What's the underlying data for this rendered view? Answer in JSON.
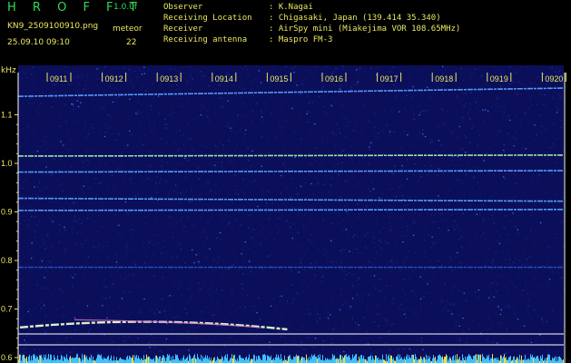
{
  "header": {
    "app_title": "H R O F F T",
    "version": "1.0.0f",
    "file_name": "KN9_2509100910.png",
    "meteor_label": "meteor",
    "datetime": "25.09.10 09:10",
    "meteor_count": "22",
    "info": [
      {
        "label": "Observer",
        "value": ": K.Nagai"
      },
      {
        "label": "Receiving Location",
        "value": ": Chigasaki, Japan (139.414 35.340)"
      },
      {
        "label": "Receiver",
        "value": ": AirSpy mini (Miakejima VOR 108.65MHz)"
      },
      {
        "label": "Receiving antenna",
        "value": ": Maspro FM-3"
      }
    ]
  },
  "spectrogram": {
    "y_unit": "kHz",
    "y_ticks": [
      "1.1",
      "1.0",
      "0.9",
      "0.8",
      "0.7",
      "0.6"
    ],
    "y_tick_values": [
      1.1,
      1.0,
      0.9,
      0.8,
      0.7,
      0.6
    ],
    "time_ticks": [
      "0911",
      "0912",
      "0913",
      "0914",
      "0915",
      "0916",
      "0917",
      "0918",
      "0919",
      "0920"
    ],
    "background_color": "#0b0f5a",
    "signals": [
      {
        "freq_start": 1.138,
        "freq_end": 1.155,
        "time_start": 0.0,
        "time_end": 10.0,
        "color": "#5aa0ff"
      },
      {
        "freq_start": 1.015,
        "freq_end": 1.017,
        "time_start": 0.0,
        "time_end": 10.0,
        "color": "#9cf0b0"
      },
      {
        "freq_start": 0.982,
        "freq_end": 0.985,
        "time_start": 0.0,
        "time_end": 10.0,
        "color": "#5aa0ff"
      },
      {
        "freq_start": 0.928,
        "freq_end": 0.922,
        "time_start": 0.0,
        "time_end": 10.0,
        "color": "#5aa0ff"
      },
      {
        "freq_start": 0.903,
        "freq_end": 0.905,
        "time_start": 0.0,
        "time_end": 10.0,
        "color": "#5aa0ff"
      },
      {
        "freq_start": 0.786,
        "freq_end": 0.786,
        "time_start": 0.0,
        "time_end": 10.0,
        "color": "#2a50c0"
      }
    ],
    "meteor_echo": {
      "freq_start": 0.662,
      "freq_peak": 0.676,
      "freq_end": 0.658,
      "time_start": 0.0,
      "time_end": 4.1
    },
    "colors": {
      "accent_yellow": "#e8e860",
      "accent_green": "#2fdc55",
      "axis_white": "#ffffff",
      "bottom_band": "#40c0ff"
    }
  }
}
